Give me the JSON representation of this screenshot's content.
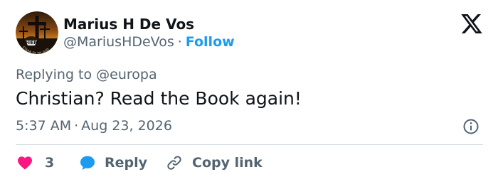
{
  "user": {
    "display_name": "Marius H De Vos",
    "handle": "@MariusHDeVos",
    "separator": "·",
    "follow_label": "Follow",
    "avatar_text": {
      "badge": "HIER",
      "ring": "STAAN EK MY GOD"
    }
  },
  "reply_context": {
    "prefix": "Replying to",
    "target": "@europa"
  },
  "tweet": {
    "text": "Christian? Read the Book again!",
    "time": "5:37 AM",
    "separator": "·",
    "date": "Aug 23, 2026"
  },
  "actions": {
    "like_count": "3",
    "reply_label": "Reply",
    "copy_label": "Copy link"
  },
  "icons": {
    "brand": "x-logo-icon",
    "info": "info-icon",
    "like": "heart-icon",
    "reply": "speech-bubble-icon",
    "copy": "link-icon"
  },
  "colors": {
    "text_primary": "#0f1419",
    "text_secondary": "#536471",
    "accent": "#1d9bf0",
    "like": "#f91880",
    "reply_bubble": "#1d9bf0",
    "divider": "#cfd9de"
  }
}
